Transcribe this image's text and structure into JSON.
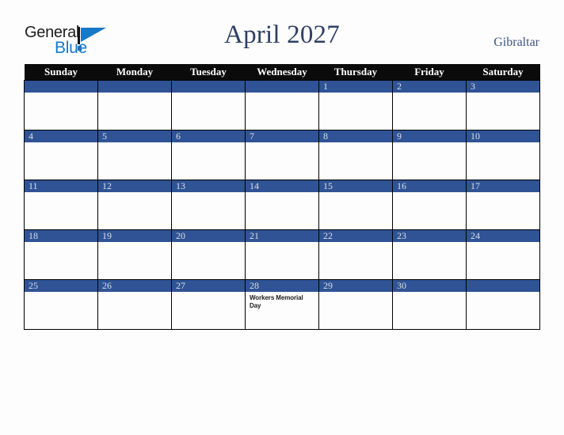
{
  "brand": {
    "word_one": "General",
    "word_two": "Blue",
    "mark_icon": "triangle-logo-icon",
    "accent_color": "#1678c8"
  },
  "header": {
    "title": "April 2027",
    "country": "Gibraltar"
  },
  "theme": {
    "header_bg": "#0b0b0b",
    "day_bar": "#2f5395",
    "title_color": "#2d3f63",
    "page_bg": "#fdfdfd",
    "border": "#000000"
  },
  "calendar": {
    "weekday_headers": [
      "Sunday",
      "Monday",
      "Tuesday",
      "Wednesday",
      "Thursday",
      "Friday",
      "Saturday"
    ],
    "weeks": [
      [
        {
          "day": "",
          "event": ""
        },
        {
          "day": "",
          "event": ""
        },
        {
          "day": "",
          "event": ""
        },
        {
          "day": "",
          "event": ""
        },
        {
          "day": "1",
          "event": ""
        },
        {
          "day": "2",
          "event": ""
        },
        {
          "day": "3",
          "event": ""
        }
      ],
      [
        {
          "day": "4",
          "event": ""
        },
        {
          "day": "5",
          "event": ""
        },
        {
          "day": "6",
          "event": ""
        },
        {
          "day": "7",
          "event": ""
        },
        {
          "day": "8",
          "event": ""
        },
        {
          "day": "9",
          "event": ""
        },
        {
          "day": "10",
          "event": ""
        }
      ],
      [
        {
          "day": "11",
          "event": ""
        },
        {
          "day": "12",
          "event": ""
        },
        {
          "day": "13",
          "event": ""
        },
        {
          "day": "14",
          "event": ""
        },
        {
          "day": "15",
          "event": ""
        },
        {
          "day": "16",
          "event": ""
        },
        {
          "day": "17",
          "event": ""
        }
      ],
      [
        {
          "day": "18",
          "event": ""
        },
        {
          "day": "19",
          "event": ""
        },
        {
          "day": "20",
          "event": ""
        },
        {
          "day": "21",
          "event": ""
        },
        {
          "day": "22",
          "event": ""
        },
        {
          "day": "23",
          "event": ""
        },
        {
          "day": "24",
          "event": ""
        }
      ],
      [
        {
          "day": "25",
          "event": ""
        },
        {
          "day": "26",
          "event": ""
        },
        {
          "day": "27",
          "event": ""
        },
        {
          "day": "28",
          "event": "Workers Memorial Day"
        },
        {
          "day": "29",
          "event": ""
        },
        {
          "day": "30",
          "event": ""
        },
        {
          "day": "",
          "event": ""
        }
      ]
    ]
  }
}
